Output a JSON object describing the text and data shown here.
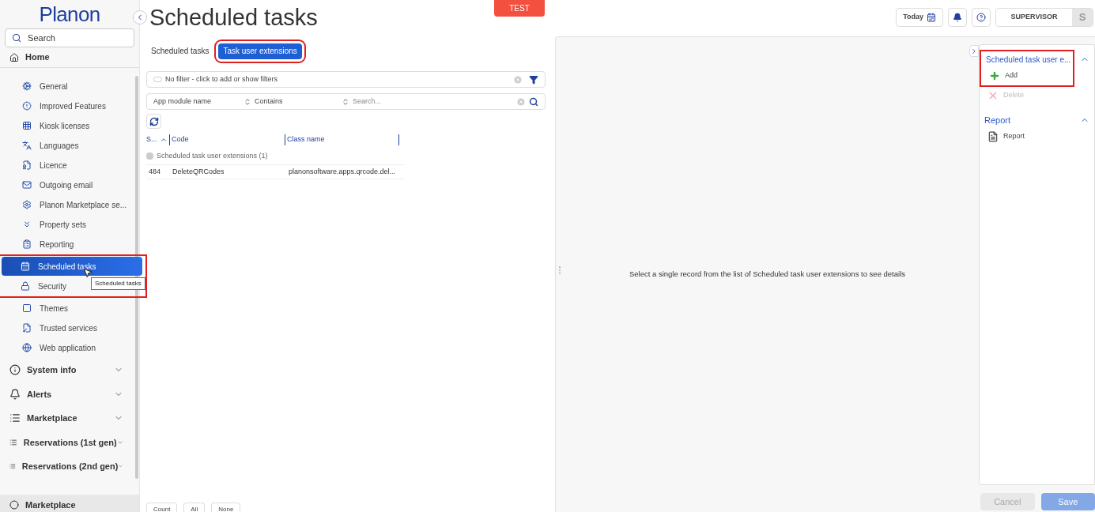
{
  "logo": "Planon",
  "sidebar": {
    "search": {
      "placeholder": "Search"
    },
    "home": "Home",
    "items": [
      {
        "kind": "sub",
        "label": "General",
        "selected": false
      },
      {
        "kind": "sub",
        "label": "Improved Features",
        "selected": false
      },
      {
        "kind": "sub",
        "label": "Kiosk licenses",
        "selected": false
      },
      {
        "kind": "sub",
        "label": "Languages",
        "selected": false
      },
      {
        "kind": "sub",
        "label": "Licence",
        "selected": false
      },
      {
        "kind": "sub",
        "label": "Outgoing email",
        "selected": false
      },
      {
        "kind": "sub",
        "label": "Planon Marketplace se...",
        "selected": false
      },
      {
        "kind": "sub",
        "label": "Property sets",
        "selected": false
      },
      {
        "kind": "sub",
        "label": "Reporting",
        "selected": false
      },
      {
        "kind": "sub",
        "label": "Scheduled tasks",
        "selected": true
      },
      {
        "kind": "sub",
        "label": "Security",
        "selected": false
      },
      {
        "kind": "sub",
        "label": "Themes",
        "selected": false
      },
      {
        "kind": "sub",
        "label": "Trusted services",
        "selected": false
      },
      {
        "kind": "sub",
        "label": "Web application",
        "selected": false
      },
      {
        "kind": "group",
        "label": "System info",
        "selected": false
      },
      {
        "kind": "group",
        "label": "Alerts",
        "selected": false
      },
      {
        "kind": "group",
        "label": "Marketplace",
        "selected": false
      },
      {
        "kind": "group",
        "label": "Reservations (1st gen)",
        "selected": false
      },
      {
        "kind": "group",
        "label": "Reservations (2nd gen)",
        "selected": false
      }
    ],
    "tooltip": "Scheduled tasks",
    "footer": "Marketplace"
  },
  "page_title": "Scheduled tasks",
  "env_badge": "TEST",
  "topbar": {
    "today": "Today",
    "user": "SUPERVISOR",
    "avatar": "S"
  },
  "tabs": [
    {
      "label": "Scheduled tasks",
      "selected": false
    },
    {
      "label": "Task user extensions",
      "selected": true
    }
  ],
  "filter": {
    "text": "No filter - click to add or show filters"
  },
  "search_row": {
    "field": "App module name",
    "operator": "Contains",
    "placeholder": "Search..."
  },
  "table": {
    "columns": [
      "S...",
      "Code",
      "Class name"
    ],
    "group": {
      "label": "Scheduled task user extensions (1)",
      "checked": true
    },
    "rows": [
      [
        "484",
        "DeleteQRCodes",
        "planonsoftware.apps.qrcode.del..."
      ]
    ]
  },
  "list_buttons": [
    "Count",
    "All",
    "None"
  ],
  "detail_message": "Select a single record from the list of Scheduled task user extensions to see details",
  "actions": [
    {
      "title": "Scheduled task user e...",
      "items": [
        {
          "kind": "add",
          "label": "Add",
          "disabled": false
        },
        {
          "kind": "delete",
          "label": "Delete",
          "disabled": true
        }
      ]
    },
    {
      "title": "Report",
      "items": [
        {
          "kind": "report",
          "label": "Report",
          "disabled": false
        }
      ]
    }
  ],
  "footer_buttons": [
    {
      "label": "Cancel",
      "disabled": true,
      "kind": "cancel"
    },
    {
      "label": "Save",
      "disabled": true,
      "kind": "save"
    }
  ]
}
